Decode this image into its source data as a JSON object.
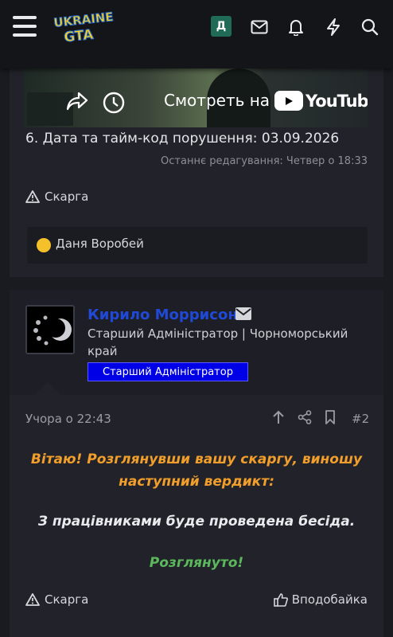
{
  "header": {
    "logo_text_top": "UKRAINE",
    "logo_text_bottom": "GTA",
    "avatar_letter": "Д",
    "icons": [
      "menu-icon",
      "mail-icon",
      "bell-icon",
      "bolt-icon",
      "search-icon"
    ]
  },
  "post1": {
    "video_cta": "Смотреть на",
    "youtube_word": "YouTube",
    "line6": "6. Дата та тайм-код порушення: 03.09.2026",
    "edited": "Останнє редагування: Четвер о 18:33",
    "complaint": "Скарга",
    "reaction_user": "Даня Воробей"
  },
  "post2": {
    "author_name": "Кирило Моррисон",
    "author_role": "Старший Адміністратор | Чорноморський край",
    "author_badge": "Старший Адміністратор",
    "time": "Учора о 22:43",
    "number": "#2",
    "message_line1": "Вітаю! Розглянувши вашу скаргу, виношу наступний вердикт:",
    "message_line2": "З працівниками буде проведена бесіда.",
    "message_line3": "Розглянуто!",
    "complaint": "Скарга",
    "like": "Вподобайка"
  },
  "colors": {
    "background": "#1a1b21",
    "post": "#22232a",
    "author_name": "#1f49d6",
    "badge": "#0000e6",
    "message_orange": "#f19e2b",
    "message_green": "#5cb85c",
    "avatar_bg": "#1f6b57"
  }
}
